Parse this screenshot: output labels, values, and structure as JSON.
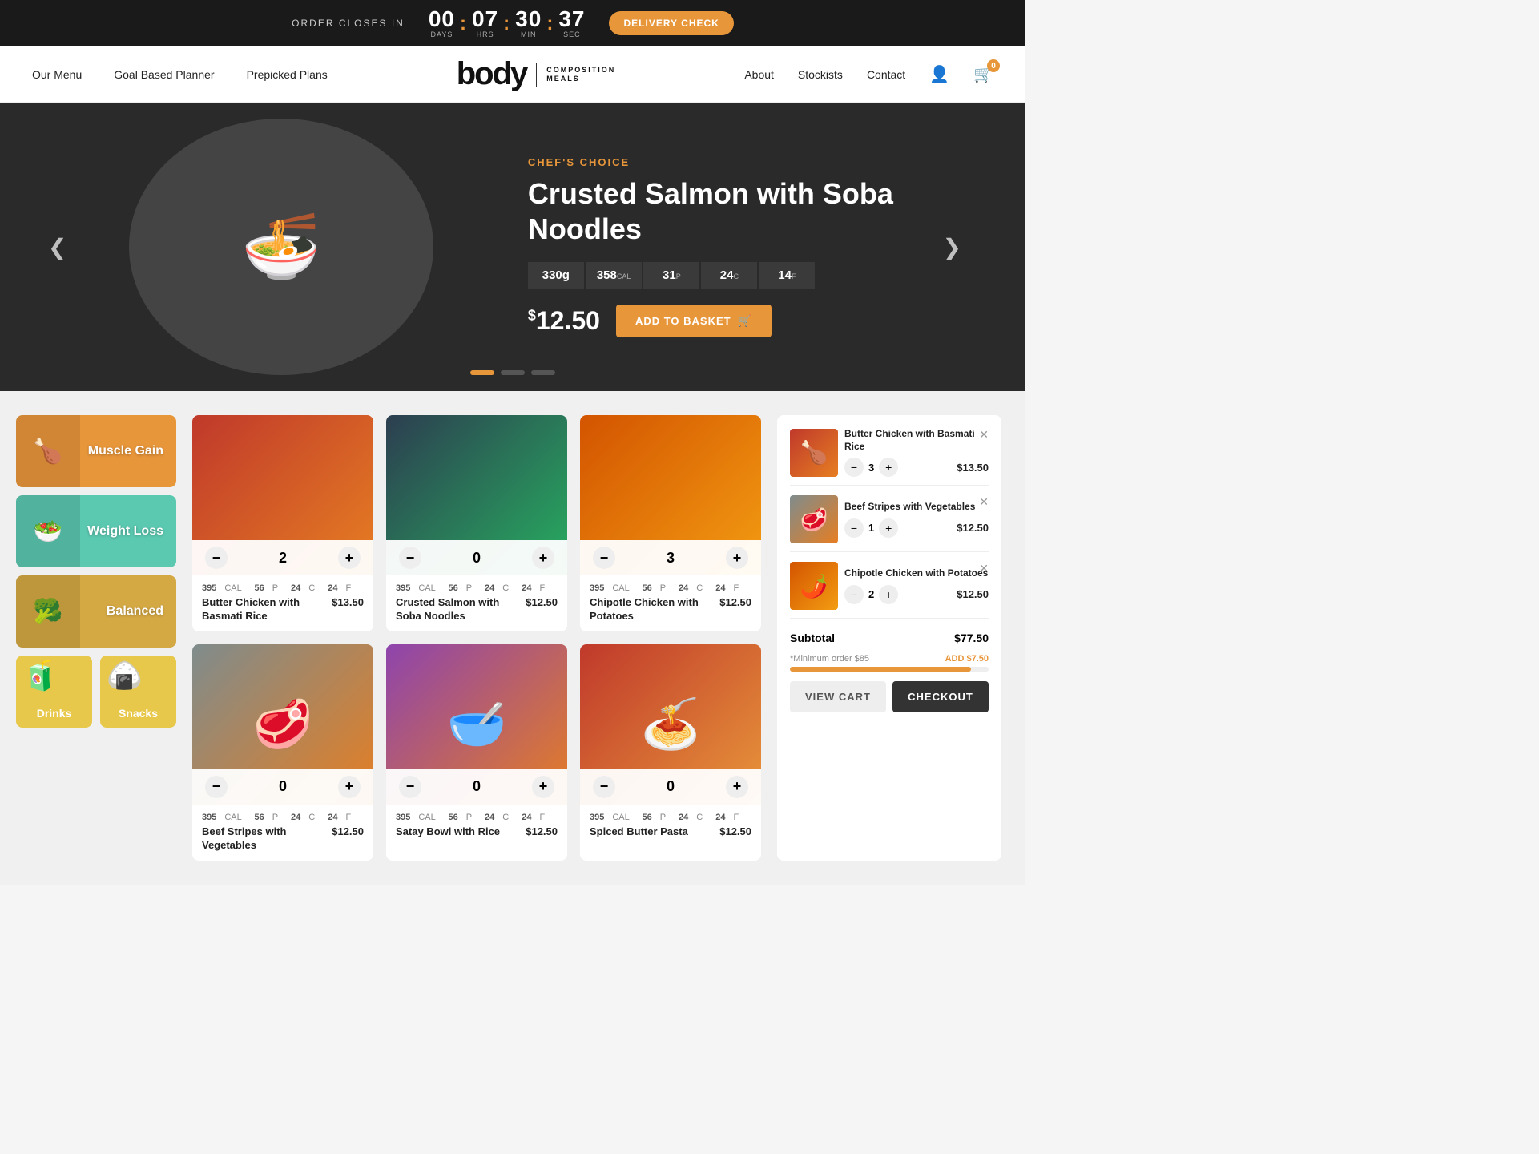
{
  "topbar": {
    "order_label": "ORDER CLOSES IN",
    "timer": {
      "days": "00",
      "days_label": "DAYS",
      "hrs": "07",
      "hrs_label": "HRS",
      "min": "30",
      "min_label": "MIN",
      "sec": "37",
      "sec_label": "SEC"
    },
    "delivery_btn": "DELIVERY CHECK"
  },
  "nav": {
    "links": [
      {
        "label": "Our Menu",
        "id": "our-menu"
      },
      {
        "label": "Goal Based Planner",
        "id": "goal-planner"
      },
      {
        "label": "Prepicked Plans",
        "id": "prepicked"
      },
      {
        "label": "About",
        "id": "about"
      },
      {
        "label": "Stockists",
        "id": "stockists"
      },
      {
        "label": "Contact",
        "id": "contact"
      }
    ],
    "logo_text": "body",
    "logo_sub_line1": "COMPOSITION",
    "logo_sub_line2": "MEALS",
    "cart_count": "0"
  },
  "hero": {
    "badge": "CHEF'S CHOICE",
    "title": "Crusted Salmon with Soba Noodles",
    "macros": [
      {
        "value": "330g",
        "label": ""
      },
      {
        "value": "358",
        "label": "CAL"
      },
      {
        "value": "31",
        "label": "P"
      },
      {
        "value": "24",
        "label": "C"
      },
      {
        "value": "14",
        "label": "F"
      }
    ],
    "price": "12.50",
    "add_to_basket": "ADD TO BASKET",
    "prev_arrow": "❮",
    "next_arrow": "❯"
  },
  "sidebar": {
    "categories": [
      {
        "label": "Muscle Gain",
        "class": "muscle"
      },
      {
        "label": "Weight Loss",
        "class": "weight"
      },
      {
        "label": "Balanced",
        "class": "balanced"
      }
    ],
    "bottom": [
      {
        "label": "Drinks",
        "class": "drinks"
      },
      {
        "label": "Snacks",
        "class": "snacks"
      }
    ]
  },
  "products": [
    {
      "name": "Butter Chicken with Basmati Rice",
      "price": "$13.50",
      "cal": "395",
      "p": "56",
      "c": "24",
      "f": "24",
      "qty": "2",
      "img_class": "img-butter-chicken"
    },
    {
      "name": "Crusted Salmon with Soba Noodles",
      "price": "$12.50",
      "cal": "395",
      "p": "56",
      "c": "24",
      "f": "24",
      "qty": "0",
      "img_class": "img-crusted-salmon"
    },
    {
      "name": "Chipotle Chicken with Potatoes",
      "price": "$12.50",
      "cal": "395",
      "p": "56",
      "c": "24",
      "f": "24",
      "qty": "3",
      "img_class": "img-chipotle"
    },
    {
      "name": "Beef Stripes with Vegetables",
      "price": "$12.50",
      "cal": "395",
      "p": "56",
      "c": "24",
      "f": "24",
      "qty": "0",
      "img_class": "img-beef"
    },
    {
      "name": "Satay Bowl with Rice",
      "price": "$12.50",
      "cal": "395",
      "p": "56",
      "c": "24",
      "f": "24",
      "qty": "0",
      "img_class": "img-bowl2"
    },
    {
      "name": "Spiced Butter Pasta",
      "price": "$12.50",
      "cal": "395",
      "p": "56",
      "c": "24",
      "f": "24",
      "qty": "0",
      "img_class": "img-pasta"
    }
  ],
  "cart": {
    "items": [
      {
        "name": "Butter Chicken with Basmati Rice",
        "qty": "3",
        "price": "$13.50",
        "img_class": "img-butter-chicken"
      },
      {
        "name": "Beef Stripes with Vegetables",
        "qty": "1",
        "price": "$12.50",
        "img_class": "img-beef"
      },
      {
        "name": "Chipotle Chicken with Potatoes",
        "qty": "2",
        "price": "$12.50",
        "img_class": "img-chipotle"
      }
    ],
    "subtotal_label": "Subtotal",
    "subtotal": "$77.50",
    "minimum_note": "*Minimum order $85",
    "add_label": "ADD $7.50",
    "progress_pct": 91,
    "view_cart": "VIEW CART",
    "checkout": "CHECKOUT"
  }
}
